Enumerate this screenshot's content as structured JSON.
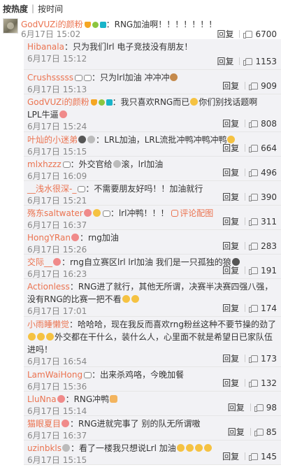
{
  "sort": {
    "hot": "按热度",
    "sep": "|",
    "time": "按时间"
  },
  "top": {
    "user": "GodVUZi的颜粉",
    "text": "：RNG加油啊！！！！！！！",
    "time": "6月17日 15:02",
    "reply": "回复",
    "likes": "6700"
  },
  "replies": [
    {
      "user": "Hibanala",
      "text": "：只为我们lrl 电子竞技没有朋友！",
      "time": "6月17日 15:12",
      "likes": "1153"
    },
    {
      "user": "Crushsssss",
      "text": "：只为lrl加油 冲冲冲",
      "time": "6月17日 15:13",
      "likes": "909"
    },
    {
      "user": "GodVUZi的颜粉",
      "text": "：我只喜欢RNG而已",
      "text2": "你们别找话题啊",
      "text3": "LPL牛逼",
      "time": "6月17日 15:24",
      "likes": "808"
    },
    {
      "user": "叶灿的小迷弟",
      "text": "：LRL加油，LRL流批",
      "text2": "冲鸭冲鸭冲鸭",
      "time": "6月17日 15:15",
      "likes": "664"
    },
    {
      "user": "mlxhzzz",
      "text": "：外交官给",
      "text2": "滚，lrl加油",
      "time": "6月17日 16:09",
      "likes": "496"
    },
    {
      "user": "__浅水很深-_",
      "text": "：不需要朋友好吗！！加油就行",
      "time": "6月17日 15:21",
      "likes": "390"
    },
    {
      "user": "殇东saltwater",
      "text": "：lrl冲鸭！！！",
      "link": "评论配图",
      "time": "6月17日 16:37",
      "likes": "311"
    },
    {
      "user": "HongYRan",
      "text": "：rng加油",
      "time": "6月17日 15:26",
      "likes": "283"
    },
    {
      "user": "交际__",
      "text": "：rng自立赛区lrl lrl加油 我们是一只孤独的狼",
      "time": "6月17日 16:23",
      "likes": "191"
    },
    {
      "user": "Actionless",
      "text": "：RNG进了就行，其他无所谓，决赛半决赛四强八强，没有RNG的比赛一把不看",
      "time": "6月17日 17:01",
      "likes": "174"
    },
    {
      "user": "小雨睡懒觉",
      "text": "：哈哈哈，现在我反而喜欢rng粉丝这种不要节操的劲了",
      "text2": "外交都在干什么，装什么人，心里面不就是希望日已家队伍进吗！",
      "time": "6月17日 16:54",
      "likes": "173"
    },
    {
      "user": "LamWaiHong",
      "text": "：出来杀鸡咯，今晚加餐",
      "time": "6月17日 15:36",
      "likes": "132"
    },
    {
      "user": "LluNna",
      "text": "：RNG冲鸭",
      "time": "6月17日 15:14",
      "likes": "98"
    },
    {
      "user": "猫眼夏目",
      "text": "：RNG进就完事了  别的队无所谓嗷",
      "time": "6月17日 16:37",
      "likes": "85"
    },
    {
      "user": "uzinbkls",
      "text": "：看了一楼我只想说Lrl 加油",
      "time": "6月17日 15:15",
      "likes": "145"
    }
  ],
  "reply_label": "回复"
}
